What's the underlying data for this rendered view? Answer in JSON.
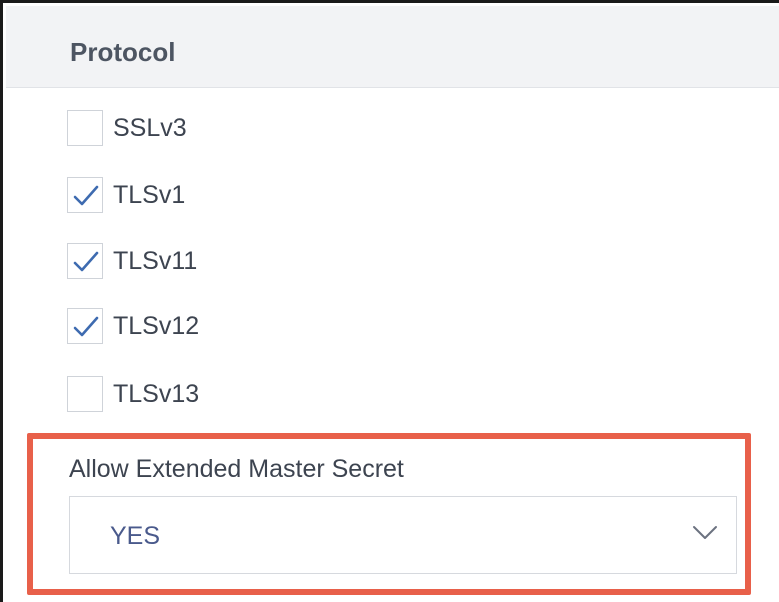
{
  "section": {
    "title": "Protocol"
  },
  "protocols": [
    {
      "label": "SSLv3",
      "checked": false
    },
    {
      "label": "TLSv1",
      "checked": true
    },
    {
      "label": "TLSv11",
      "checked": true
    },
    {
      "label": "TLSv12",
      "checked": true
    },
    {
      "label": "TLSv13",
      "checked": false
    }
  ],
  "extended_master_secret": {
    "label": "Allow Extended Master Secret",
    "value": "YES"
  },
  "colors": {
    "highlight": "#e8604a",
    "check": "#3e6bb0",
    "select_text": "#4a5a8c"
  },
  "icons": {
    "check": "check-icon",
    "dropdown": "chevron-down-icon"
  }
}
